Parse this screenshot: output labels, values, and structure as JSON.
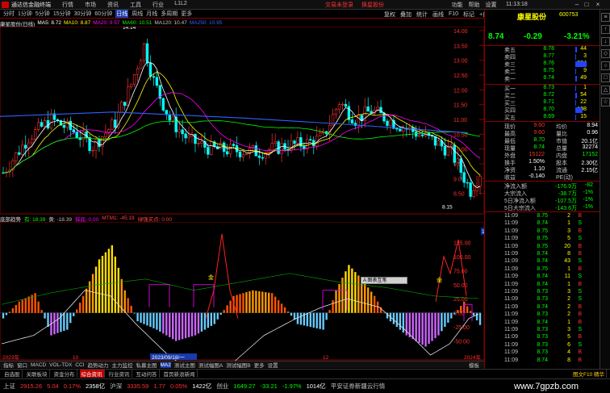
{
  "titlebar": {
    "app_title": "通达信金融终端",
    "menu": [
      "行情",
      "市场",
      "资讯",
      "工具",
      "行业",
      "L1L2"
    ],
    "notice": "交易未登录",
    "notice2": "换星股份",
    "right_menu": [
      "功能",
      "帮助",
      "设置"
    ],
    "time": "11:13:18"
  },
  "periodbar": {
    "items": [
      "分时",
      "1分钟",
      "5分钟",
      "15分钟",
      "30分钟",
      "60分钟",
      "日线",
      "周线",
      "月线",
      "多周期",
      "更多"
    ],
    "active_index": 6
  },
  "rtool": [
    "复权",
    "叠加",
    "统计",
    "画线",
    "F10",
    "标记",
    "+自选",
    "返回"
  ],
  "chart_header": {
    "name": "康星股份(日线)",
    "indicators": [
      {
        "label": "MA5: 8.72",
        "color": "#ffffff"
      },
      {
        "label": "MA10: 8.87",
        "color": "#ffff00"
      },
      {
        "label": "MA20: 9.57",
        "color": "#ff00ff"
      },
      {
        "label": "MA60: 10.51",
        "color": "#00ff00"
      },
      {
        "label": "MA120: 10.47",
        "color": "#c0c0c0"
      },
      {
        "label": "MA250: 10.95",
        "color": "#3060ff"
      }
    ]
  },
  "main_chart": {
    "price_axis": [
      "14.00",
      "13.50",
      "13.00",
      "12.50",
      "12.00",
      "11.50",
      "11.00",
      "10.50",
      "10.00",
      "9.50",
      "9.00",
      "8.50"
    ],
    "high_label": "14.14",
    "low_label": "8.15"
  },
  "sub_header": {
    "name": "底部趋势",
    "items": [
      {
        "label": "有: 18.39",
        "color": "#00ff00"
      },
      {
        "label": "黄: -18.39",
        "color": "#c0c0c0"
      },
      {
        "label": "探底: 0.00",
        "color": "#ff00ff"
      },
      {
        "label": "MTM1: -45.19",
        "color": "#ff4040"
      },
      {
        "label": "绿强买点: 0.00",
        "color": "#ff4040"
      }
    ]
  },
  "sub_chart": {
    "axis": [
      "125.00",
      "100.00",
      "75.00",
      "50.00",
      "25.00",
      "0.00",
      "-25.00",
      "-50.00"
    ],
    "current_tag": "144.24",
    "annotations": [
      "金",
      "金",
      "金"
    ],
    "popup": "A 图表互笔"
  },
  "timeline": {
    "labels": [
      "2023年",
      "10",
      "11",
      "12",
      "2024年"
    ],
    "cursor_date": "2023/09/18/一"
  },
  "tabs1": {
    "items": [
      "指标",
      "窗口",
      "MACD",
      "VOL-TDX",
      "CCI",
      "趋势动力",
      "主力监控",
      "私募主图",
      "MA2",
      "测试主图",
      "测试幅图A",
      "测试幅图B",
      "更多",
      "设置"
    ],
    "active_index": 8,
    "right": "模板"
  },
  "tabs2": {
    "items": [
      "自选股",
      "关联板块",
      "资金分布",
      "综合资讯",
      "行业资讯",
      "互动问答",
      "首页新浪新闻"
    ],
    "active_index": 3,
    "right": "图文F10 精华"
  },
  "statusbar": {
    "items": [
      {
        "label": "上证",
        "color": "#c0c0c0"
      },
      {
        "label": "2915.26",
        "color": "#ff3030"
      },
      {
        "label": "5.04",
        "color": "#ff3030"
      },
      {
        "label": "0.17%",
        "color": "#ff3030"
      },
      {
        "label": "2358亿",
        "color": "#ffffff"
      },
      {
        "label": "沪深",
        "color": "#c0c0c0"
      },
      {
        "label": "3335.59",
        "color": "#ff3030"
      },
      {
        "label": "1.77",
        "color": "#ff3030"
      },
      {
        "label": "0.05%",
        "color": "#ff3030"
      },
      {
        "label": "1422亿",
        "color": "#ffffff"
      },
      {
        "label": "创业",
        "color": "#c0c0c0"
      },
      {
        "label": "1649.27",
        "color": "#00ff00"
      },
      {
        "label": "-33.21",
        "color": "#00ff00"
      },
      {
        "label": "-1.97%",
        "color": "#00ff00"
      },
      {
        "label": "1014亿",
        "color": "#ffffff"
      },
      {
        "label": "平安证券新疆云行情",
        "color": "#c0c0c0"
      }
    ]
  },
  "rpanel": {
    "name": "康星股份",
    "code": "600753",
    "price": "8.74",
    "change": "-0.29",
    "pct": "-3.21%",
    "asks": [
      {
        "label": "卖五",
        "price": "8.78",
        "vol": "44"
      },
      {
        "label": "卖四",
        "price": "8.77",
        "vol": "3"
      },
      {
        "label": "卖三",
        "price": "8.76",
        "vol": "304"
      },
      {
        "label": "卖二",
        "price": "8.75",
        "vol": "9"
      },
      {
        "label": "卖一",
        "price": "8.74",
        "vol": "49"
      }
    ],
    "bids": [
      {
        "label": "买一",
        "price": "8.73",
        "vol": "1"
      },
      {
        "label": "买二",
        "price": "8.72",
        "vol": "54"
      },
      {
        "label": "买三",
        "price": "8.71",
        "vol": "22"
      },
      {
        "label": "买四",
        "price": "8.70",
        "vol": "198"
      },
      {
        "label": "买五",
        "price": "8.69",
        "vol": "15"
      }
    ],
    "stats": [
      {
        "k": "现价",
        "v": "9.60",
        "k2": "均价",
        "v2": "8.94"
      },
      {
        "k": "最高",
        "v": "9.60",
        "k2": "量比",
        "v2": "0.96"
      },
      {
        "k": "最低",
        "v": "8.70",
        "k2": "市值",
        "v2": "20.1亿"
      },
      {
        "k": "现量",
        "v": "8.74",
        "k2": "总量",
        "v2": "32274"
      },
      {
        "k": "外盘",
        "v": "15122",
        "k2": "内盘",
        "v2": "17152"
      },
      {
        "k": "换手",
        "v": "1.50%",
        "k2": "股本",
        "v2": "2.30亿"
      },
      {
        "k": "净资",
        "v": "1.10",
        "k2": "流通",
        "v2": "2.15亿"
      },
      {
        "k": "收益",
        "v": "-0.140",
        "k2": "PE(动)",
        "v2": ""
      }
    ],
    "flows": [
      {
        "k": "净流入额",
        "v": "-176.9万",
        "p": "-82"
      },
      {
        "k": "大宗流入",
        "v": "-38.7万",
        "p": "-1%"
      },
      {
        "k": "5日净流入额",
        "v": "-107.5万",
        "p": "-1%"
      },
      {
        "k": "5日大宗流入",
        "v": "-143.6万",
        "p": "-1%"
      }
    ],
    "ticks": [
      {
        "t": "11:09",
        "p": "8.75",
        "v": "2",
        "d": "B"
      },
      {
        "t": "11:09",
        "p": "8.74",
        "v": "1",
        "d": "S"
      },
      {
        "t": "11:09",
        "p": "8.75",
        "v": "3",
        "d": "B"
      },
      {
        "t": "11:09",
        "p": "8.75",
        "v": "5",
        "d": "S"
      },
      {
        "t": "11:09",
        "p": "8.75",
        "v": "20",
        "d": "B"
      },
      {
        "t": "11:09",
        "p": "8.74",
        "v": "8",
        "d": "B"
      },
      {
        "t": "11:09",
        "p": "8.74",
        "v": "43",
        "d": "S"
      },
      {
        "t": "11:09",
        "p": "8.75",
        "v": "1",
        "d": "B"
      },
      {
        "t": "11:09",
        "p": "8.74",
        "v": "11",
        "d": "S"
      },
      {
        "t": "11:09",
        "p": "8.74",
        "v": "1",
        "d": "B"
      },
      {
        "t": "11:09",
        "p": "8.73",
        "v": "3",
        "d": "S"
      },
      {
        "t": "11:09",
        "p": "8.73",
        "v": "2",
        "d": "S"
      },
      {
        "t": "11:09",
        "p": "8.74",
        "v": "2",
        "d": "B"
      },
      {
        "t": "11:09",
        "p": "8.73",
        "v": "2",
        "d": "B"
      },
      {
        "t": "11:09",
        "p": "8.74",
        "v": "1",
        "d": "B"
      },
      {
        "t": "11:09",
        "p": "8.73",
        "v": "3",
        "d": "S"
      },
      {
        "t": "11:09",
        "p": "8.73",
        "v": "5",
        "d": "B"
      },
      {
        "t": "11:09",
        "p": "8.73",
        "v": "6",
        "d": "S"
      },
      {
        "t": "11:09",
        "p": "8.73",
        "v": "4",
        "d": "B"
      },
      {
        "t": "11:09",
        "p": "8.74",
        "v": "8",
        "d": "B"
      }
    ]
  },
  "watermark": "www.7gpzb.com",
  "colors": {
    "up": "#ff3030",
    "down": "#00ff00",
    "neutral": "#ffffff"
  }
}
